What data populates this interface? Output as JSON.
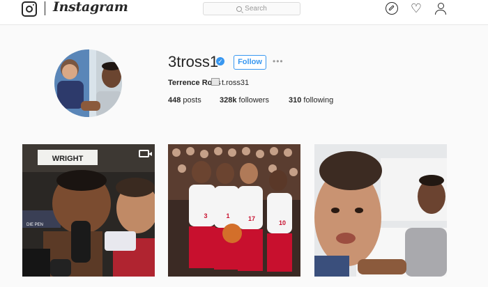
{
  "header": {
    "brand": "Instagram",
    "search_placeholder": "Search"
  },
  "profile": {
    "username": "3tross1",
    "follow_label": "Follow",
    "more_label": "•••",
    "full_name": "Terrence Ross",
    "bio_handle": "t.ross31",
    "stats": {
      "posts": "448",
      "posts_label": "posts",
      "followers": "328k",
      "followers_label": "followers",
      "following": "310",
      "following_label": "following"
    }
  },
  "colors": {
    "accent": "#3897f0",
    "raptors_red": "#c8102e"
  },
  "posts": [
    {
      "icon": "video-icon",
      "sign_text": "WRIGHT",
      "banner_text": "DIE PEN"
    },
    {
      "jerseys": [
        "3",
        "1",
        "17",
        "10"
      ]
    },
    {
      "subject": "selfie"
    }
  ]
}
